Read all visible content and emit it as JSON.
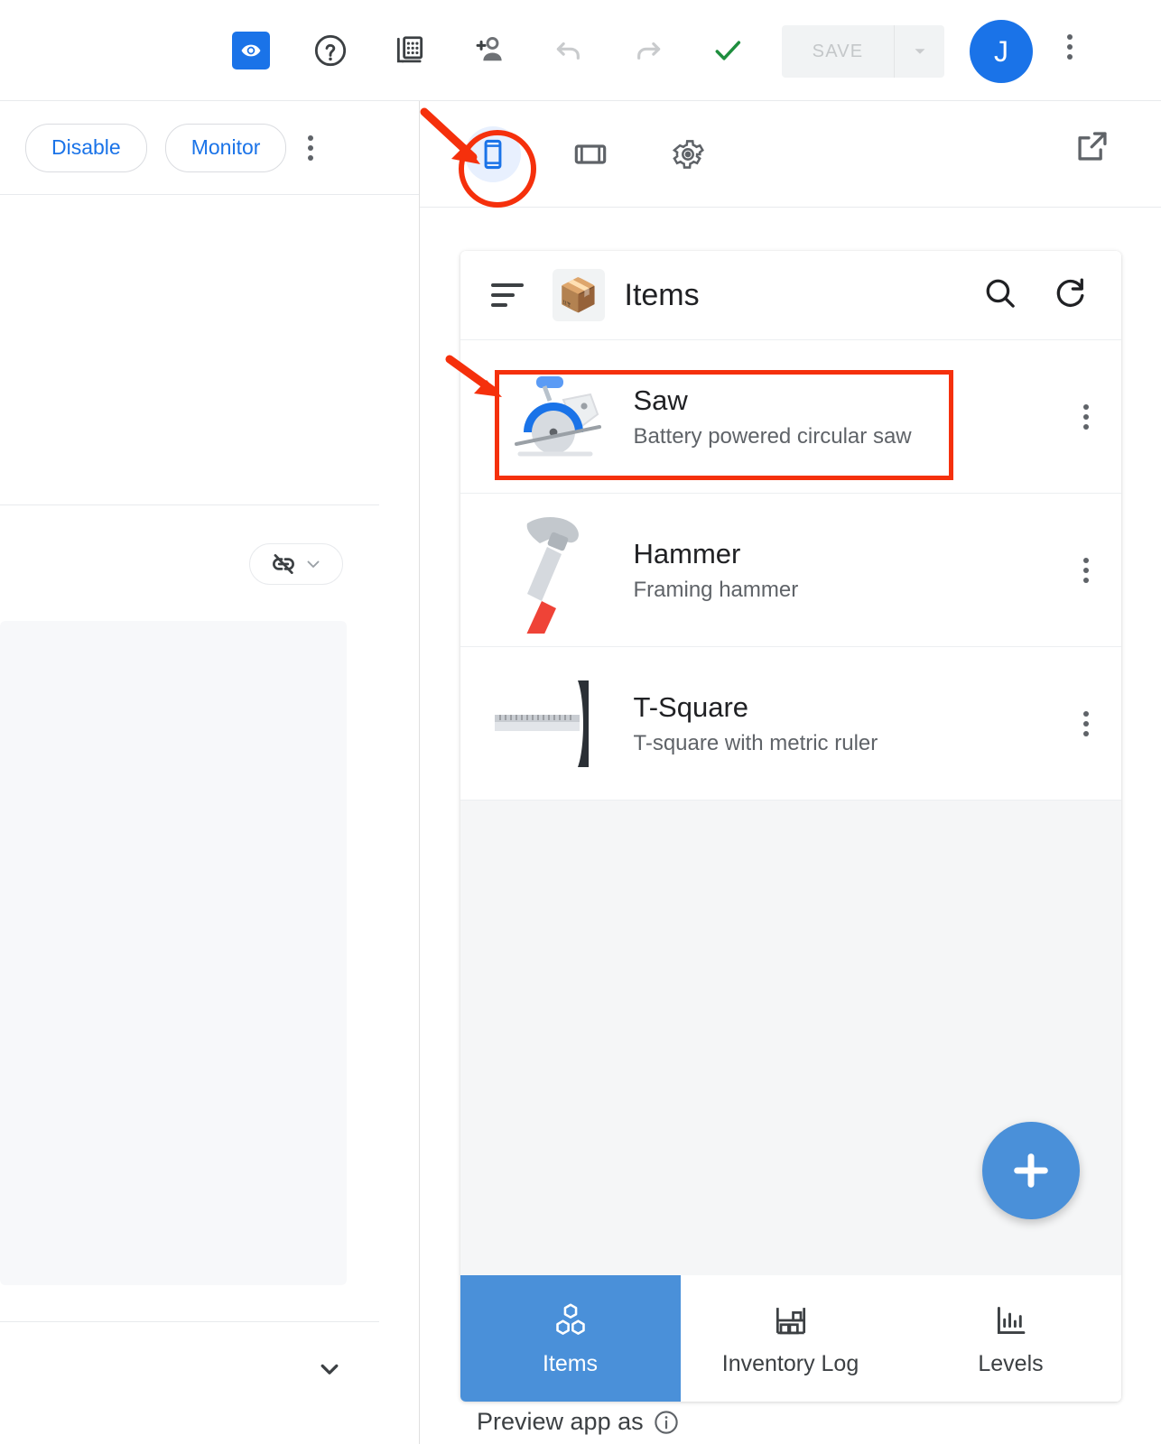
{
  "toolbar": {
    "icons": [
      {
        "name": "preview-eye-icon",
        "label": "Preview"
      },
      {
        "name": "help-circle-icon",
        "label": "Help"
      },
      {
        "name": "data-table-icon",
        "label": "Data"
      },
      {
        "name": "person-add-icon",
        "label": "Share"
      },
      {
        "name": "undo-icon",
        "label": "Undo"
      },
      {
        "name": "redo-icon",
        "label": "Redo"
      },
      {
        "name": "check-icon",
        "label": "Saved"
      }
    ],
    "save_label": "SAVE",
    "avatar_initial": "J",
    "accent_blue": "#1a73e8",
    "check_green": "#1e8e3e",
    "disabled_grey": "#c4c7c9"
  },
  "left_panel": {
    "disable_label": "Disable",
    "monitor_label": "Monitor",
    "overflow_label": "More options",
    "link_off_label": "link-off",
    "expand_label": "Expand"
  },
  "device_bar": {
    "phone_label": "Phone",
    "tablet_label": "Tablet",
    "settings_label": "Settings",
    "open_external_label": "Open in new window"
  },
  "preview": {
    "app": {
      "title": "Items",
      "logo_emoji": "📦",
      "menu_label": "Menu",
      "search_label": "Search",
      "refresh_label": "Refresh",
      "items": [
        {
          "name": "Saw",
          "description": "Battery powered circular saw",
          "icon": "circular-saw-icon",
          "highlighted": true
        },
        {
          "name": "Hammer",
          "description": "Framing hammer",
          "icon": "hammer-icon",
          "highlighted": false
        },
        {
          "name": "T-Square",
          "description": "T-square with metric ruler",
          "icon": "t-square-icon",
          "highlighted": false
        }
      ],
      "fab_label": "Add item",
      "bottom_nav": [
        {
          "label": "Items",
          "icon": "cubes-icon",
          "active": true
        },
        {
          "label": "Inventory Log",
          "icon": "shelf-icon",
          "active": false
        },
        {
          "label": "Levels",
          "icon": "bar-chart-icon",
          "active": false
        }
      ],
      "nav_active_color": "#4a90d9",
      "fab_color": "#4a90d9"
    },
    "caption": "Preview app as"
  },
  "annotations": {
    "color": "#f5300c",
    "targets": [
      "phone-device-toggle",
      "saw-list-item"
    ]
  }
}
